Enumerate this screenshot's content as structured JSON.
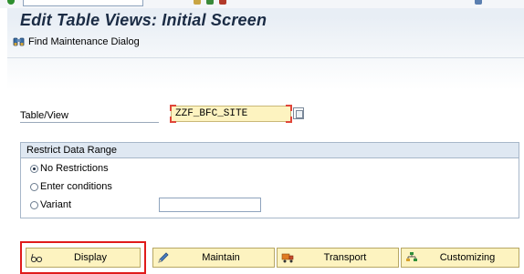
{
  "title": "Edit Table Views: Initial Screen",
  "app_toolbar": {
    "find_label": "Find Maintenance Dialog"
  },
  "table_view": {
    "label": "Table/View",
    "value": "ZZF_BFC_SITE"
  },
  "restrict": {
    "header": "Restrict Data Range",
    "options": [
      "No Restrictions",
      "Enter conditions",
      "Variant"
    ],
    "selected": "No Restrictions",
    "variant_value": ""
  },
  "buttons": {
    "display": "Display",
    "maintain": "Maintain",
    "transport": "Transport",
    "customizing": "Customizing"
  },
  "colors": {
    "title": "#1a2b44",
    "input_bg": "#fdf3c0",
    "highlight": "#e01b1b",
    "group_header": "#dfe8f2"
  },
  "icons": {
    "find": "binoculars-icon",
    "display": "glasses-icon",
    "maintain": "pencil-icon",
    "transport": "truck-icon",
    "customizing": "hierarchy-icon",
    "value_help": "value-help-icon"
  }
}
